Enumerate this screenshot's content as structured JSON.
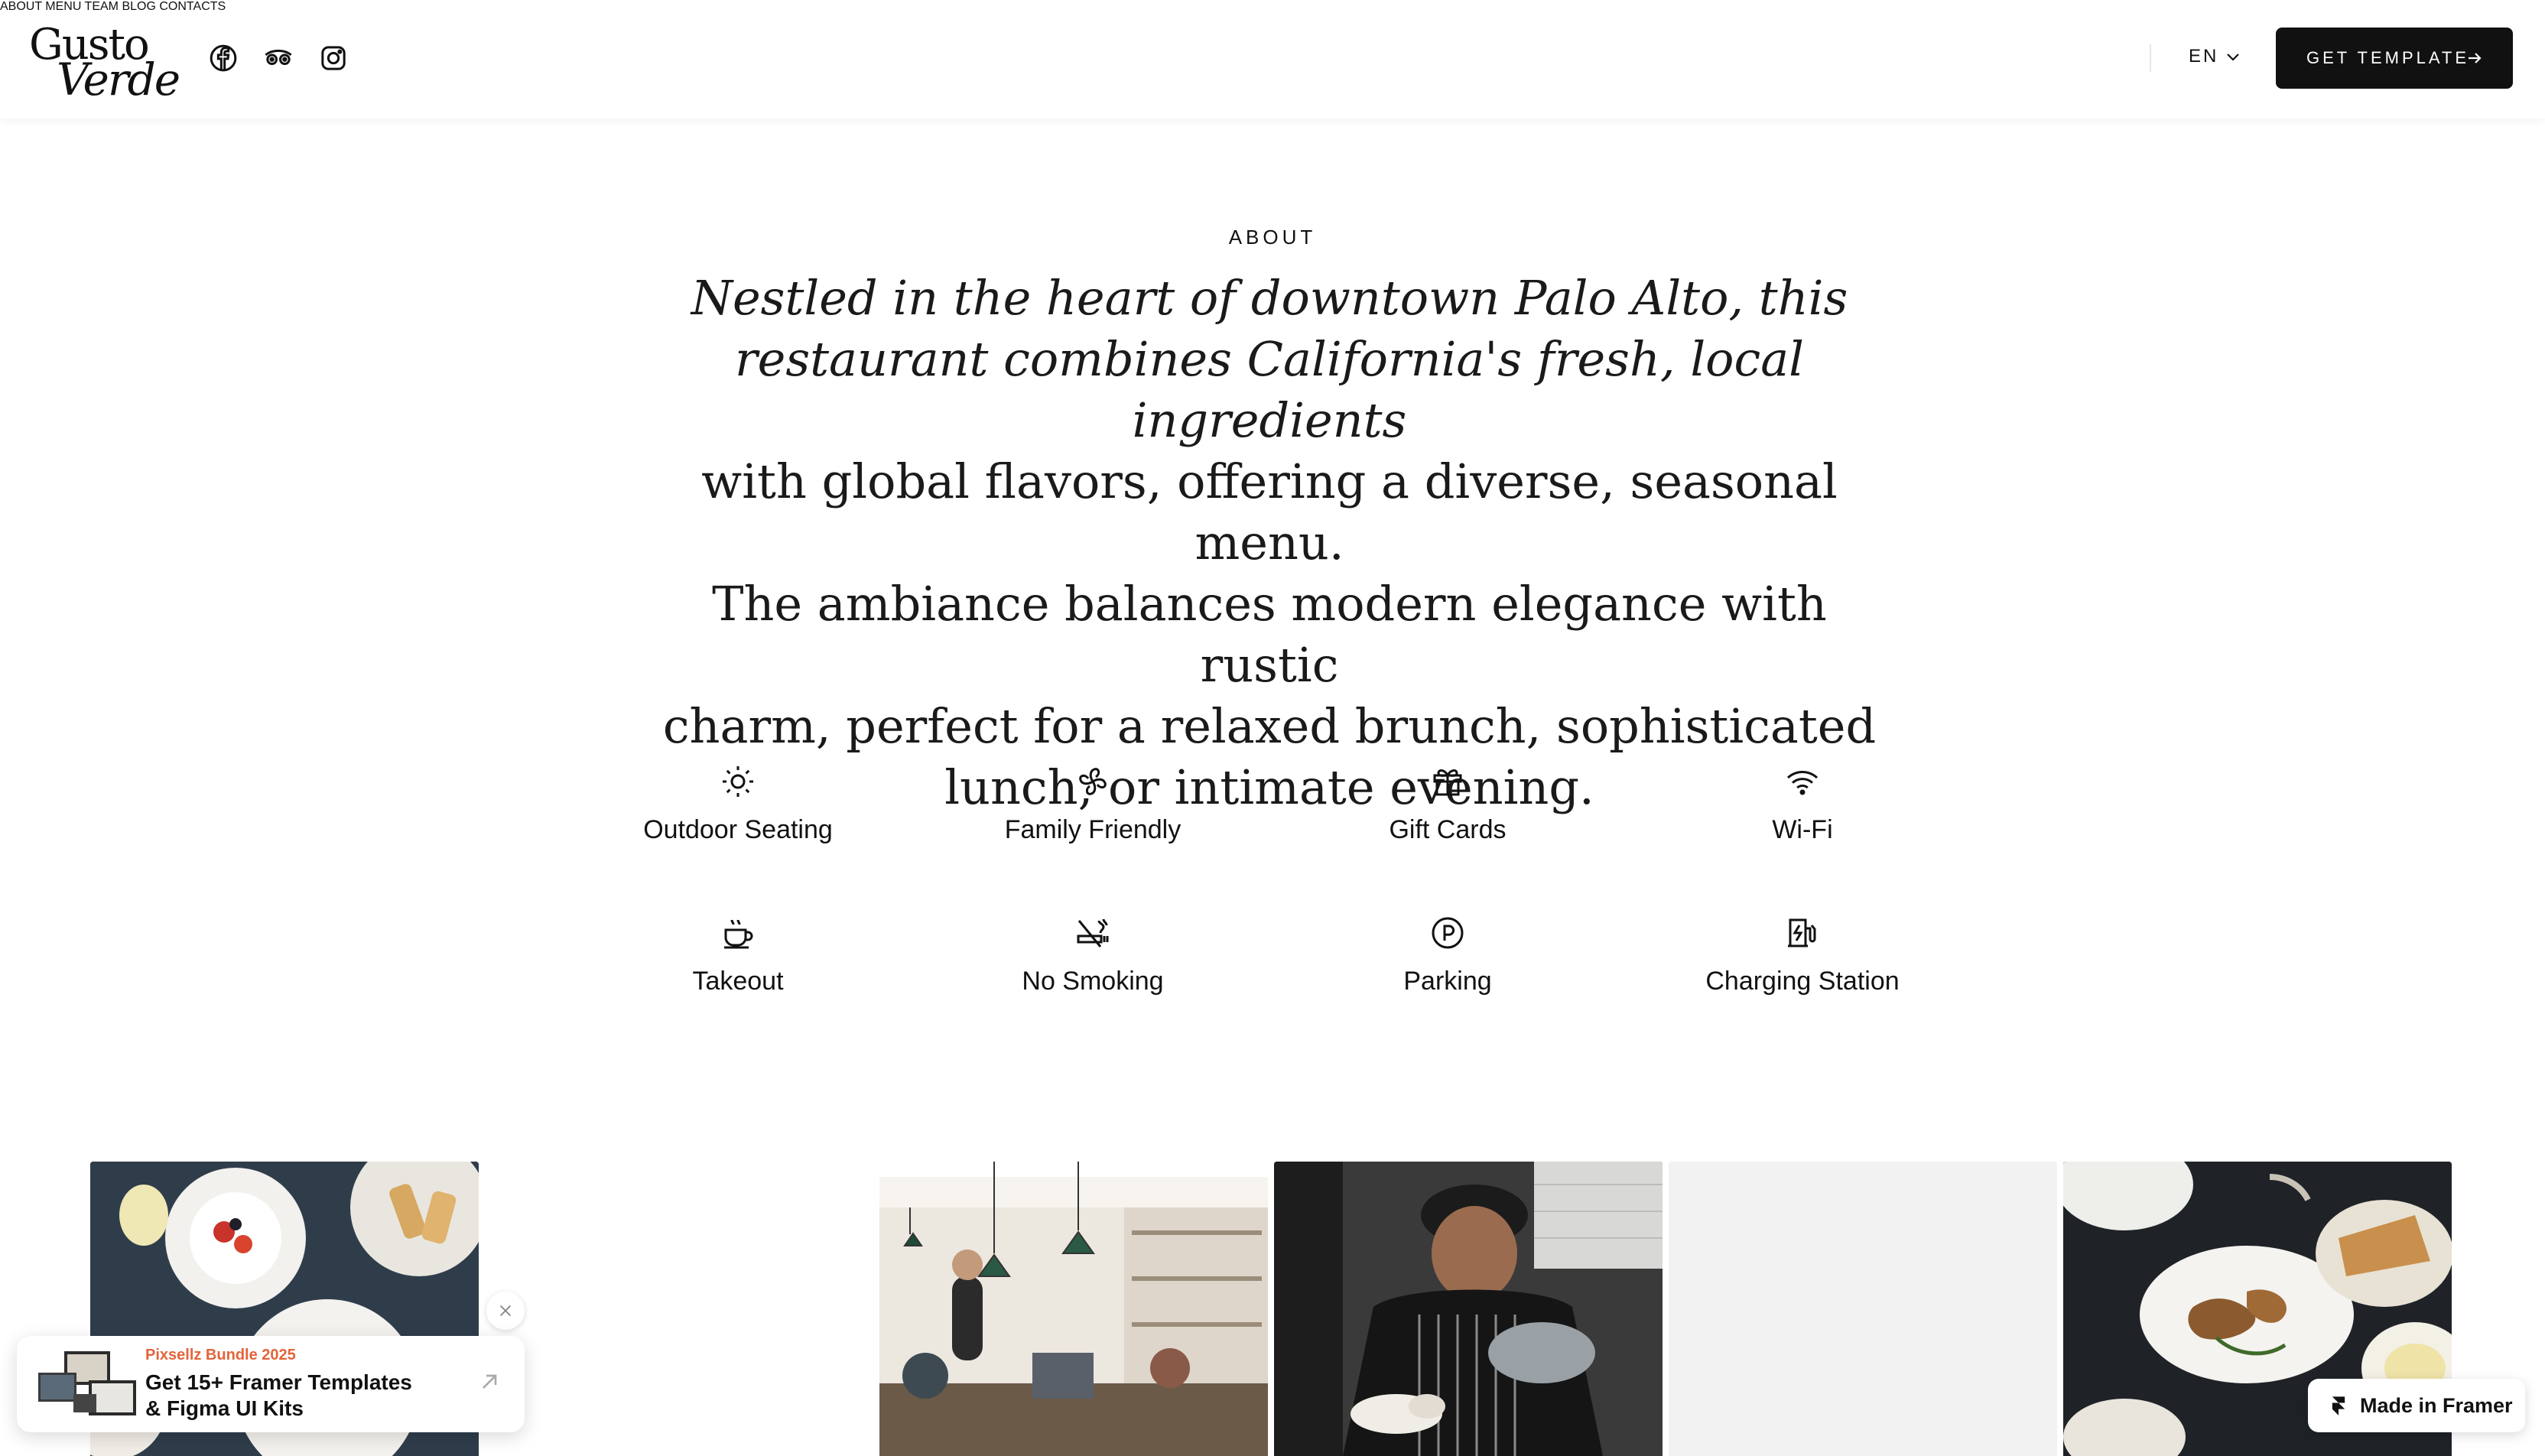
{
  "brand": {
    "line1": "Gusto",
    "line2": "Verde"
  },
  "social": [
    {
      "name": "facebook-icon"
    },
    {
      "name": "tripadvisor-icon"
    },
    {
      "name": "instagram-icon"
    }
  ],
  "nav": {
    "items": [
      "ABOUT",
      "MENU",
      "TEAM",
      "BLOG",
      "CONTACTS"
    ],
    "language": "EN",
    "cta": "GET TEMPLATE"
  },
  "about": {
    "label": "ABOUT",
    "italic_lines": [
      "Nestled in the heart of downtown Palo Alto, this",
      "restaurant combines California's fresh, local ingredients"
    ],
    "regular_lines": [
      "with global flavors, offering a diverse, seasonal menu.",
      "The ambiance balances modern elegance with rustic",
      "charm, perfect for a relaxed brunch, sophisticated",
      "lunch, or intimate evening."
    ]
  },
  "amenities": [
    {
      "label": "Outdoor Seating",
      "icon": "sun-icon"
    },
    {
      "label": "Family Friendly",
      "icon": "pinwheel-icon"
    },
    {
      "label": "Gift Cards",
      "icon": "gift-icon"
    },
    {
      "label": "Wi-Fi",
      "icon": "wifi-icon"
    },
    {
      "label": "Takeout",
      "icon": "coffee-cup-icon"
    },
    {
      "label": "No Smoking",
      "icon": "no-smoking-icon"
    },
    {
      "label": "Parking",
      "icon": "parking-icon"
    },
    {
      "label": "Charging Station",
      "icon": "ev-charger-icon"
    }
  ],
  "promo": {
    "tag": "Pixsellz Bundle 2025",
    "title_line1": "Get 15+ Framer Templates",
    "title_line2": "& Figma UI Kits"
  },
  "badge": {
    "label": "Made in Framer"
  }
}
